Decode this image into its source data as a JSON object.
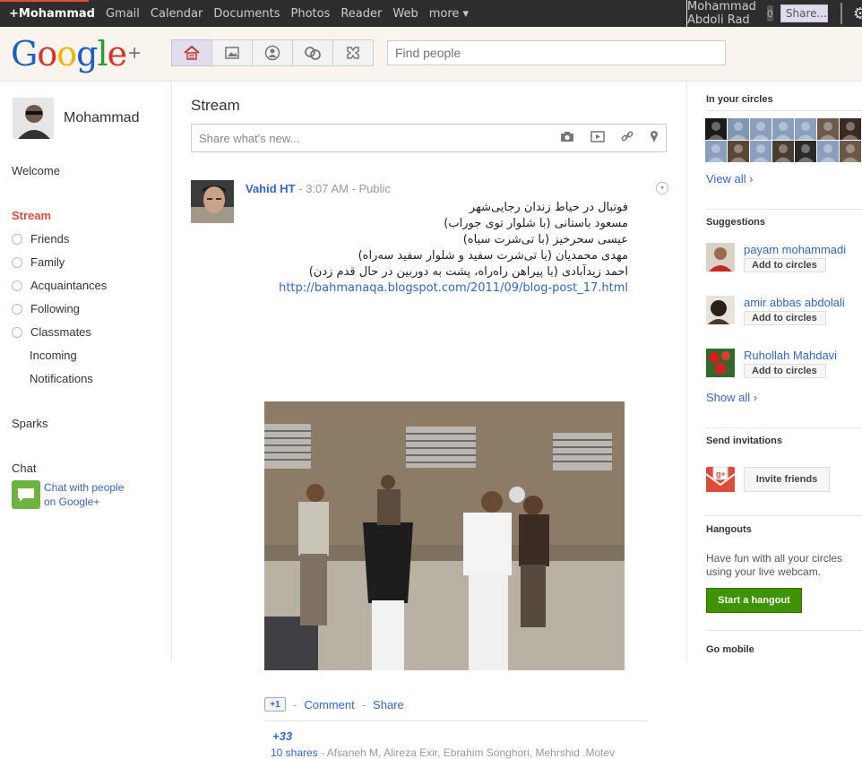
{
  "topbar": {
    "items": [
      "+Mohammad",
      "Gmail",
      "Calendar",
      "Documents",
      "Photos",
      "Reader",
      "Web",
      "more ▾"
    ],
    "username": "Mohammad Abdoli Rad",
    "notification_count": "0",
    "share_label": "Share...",
    "accent_color": "#dd4b39"
  },
  "header": {
    "logo": [
      "G",
      "o",
      "o",
      "g",
      "l",
      "e"
    ],
    "logo_plus": "+",
    "nav_icons": [
      "home-icon",
      "photos-icon",
      "profile-icon",
      "circles-icon",
      "games-icon"
    ],
    "find_people_placeholder": "Find people"
  },
  "left": {
    "profile_name": "Mohammad",
    "welcome": "Welcome",
    "stream": "Stream",
    "circles": [
      "Friends",
      "Family",
      "Acquaintances",
      "Following",
      "Classmates"
    ],
    "incoming": "Incoming",
    "notifications": "Notifications",
    "sparks": "Sparks",
    "chat_heading": "Chat",
    "chat_link_line1": "Chat with people",
    "chat_link_line2": "on Google+"
  },
  "center": {
    "title": "Stream",
    "share_placeholder": "Share what's new...",
    "share_icons": [
      "camera-icon",
      "video-icon",
      "link-icon",
      "location-icon"
    ],
    "post": {
      "author": "Vahid HT",
      "time": "3:07 AM",
      "visibility": "Public",
      "lines": [
        "فوتبال در حیاط زندان رجایی‌شهر",
        "مسعود باستانی (با شلوار توی جوراب)",
        "عیسی سحرخیز (با تی‌شرت سیاه)",
        "مهدی محمدیان (با تی‌شرت سفید و شلوار سفید سه‌راه)",
        "احمد زیدآبادی (با پیراهن راه‌راه، پشت به دوربین در حال قدم زدن)"
      ],
      "link": "http://bahmanaqa.blogspot.com/2011/09/blog-post_17.html",
      "plusone_label": "+1",
      "comment_label": "Comment",
      "share_label": "Share",
      "plus_count": "+33",
      "shares_count": "10 shares",
      "sharers": " - Afsaneh M, Alireza Exir, Ebrahim Songhori, Mehrshid .Motev"
    }
  },
  "right": {
    "in_your_circles": "In your circles",
    "view_all": "View all ›",
    "suggestions_heading": "Suggestions",
    "suggestions": [
      {
        "name": "payam mohammadi",
        "button": "Add to circles"
      },
      {
        "name": "amir abbas abdolali",
        "button": "Add to circles"
      },
      {
        "name": "Ruhollah Mahdavi",
        "button": "Add to circles"
      }
    ],
    "show_all": "Show all ›",
    "send_invitations": "Send invitations",
    "invite_button": "Invite friends",
    "hangouts_heading": "Hangouts",
    "hangouts_text_1": "Have fun with all your circles",
    "hangouts_text_2": "using your live webcam.",
    "hangout_button": "Start a hangout",
    "go_mobile": "Go mobile"
  }
}
